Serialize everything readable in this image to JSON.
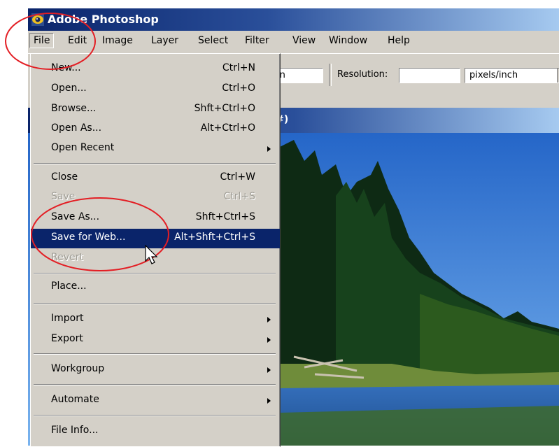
{
  "app": {
    "title": "Adobe Photoshop",
    "icon": "photoshop-eye-icon"
  },
  "menubar": {
    "items": [
      "File",
      "Edit",
      "Image",
      "Layer",
      "Select",
      "Filter",
      "View",
      "Window",
      "Help"
    ],
    "active": "File"
  },
  "options_bar": {
    "unit_value": "in",
    "resolution_label": "Resolution:",
    "resolution_value": "",
    "resolution_unit": "pixels/inch"
  },
  "document": {
    "title_fragment": "GB#)"
  },
  "file_menu": {
    "items": [
      {
        "label": "New...",
        "shortcut": "Ctrl+N"
      },
      {
        "label": "Open...",
        "shortcut": "Ctrl+O"
      },
      {
        "label": "Browse...",
        "shortcut": "Shft+Ctrl+O"
      },
      {
        "label": "Open As...",
        "shortcut": "Alt+Ctrl+O"
      },
      {
        "label": "Open Recent",
        "shortcut": "",
        "submenu": true
      },
      {
        "label": "Close",
        "shortcut": "Ctrl+W"
      },
      {
        "label": "Save",
        "shortcut": "Ctrl+S",
        "disabled": true
      },
      {
        "label": "Save As...",
        "shortcut": "Shft+Ctrl+S"
      },
      {
        "label": "Save for Web...",
        "shortcut": "Alt+Shft+Ctrl+S",
        "highlighted": true
      },
      {
        "label": "Revert",
        "shortcut": "",
        "disabled": true
      },
      {
        "label": "Place...",
        "shortcut": ""
      },
      {
        "label": "Import",
        "shortcut": "",
        "submenu": true
      },
      {
        "label": "Export",
        "shortcut": "",
        "submenu": true
      },
      {
        "label": "Workgroup",
        "shortcut": "",
        "submenu": true
      },
      {
        "label": "Automate",
        "shortcut": "",
        "submenu": true
      },
      {
        "label": "File Info...",
        "shortcut": ""
      }
    ]
  },
  "colors": {
    "highlight": "#0a246a",
    "annotation": "#e31e24",
    "menu_bg": "#d4d0c8"
  }
}
